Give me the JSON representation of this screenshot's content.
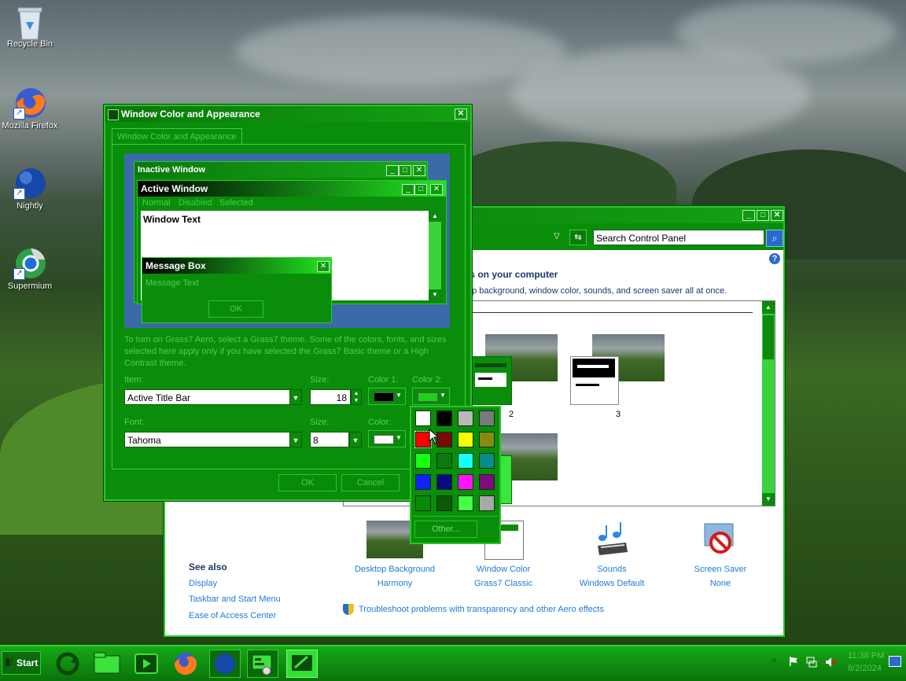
{
  "desktop": {
    "icons": [
      {
        "label": "Recycle Bin",
        "icon": "recycle-bin-icon"
      },
      {
        "label": "Mozilla Firefox",
        "icon": "firefox-icon"
      },
      {
        "label": "Nightly",
        "icon": "nightly-icon"
      },
      {
        "label": "Supermium",
        "icon": "supermium-icon"
      }
    ]
  },
  "appearance_dialog": {
    "title": "Window Color and Appearance",
    "tab_label": "Window Color and Appearance",
    "preview": {
      "inactive_title": "Inactive Window",
      "active_title": "Active Window",
      "menu_normal": "Normal",
      "menu_disabled": "Disabled",
      "menu_selected": "Selected",
      "window_text": "Window Text",
      "msgbox_title": "Message Box",
      "msgbox_text": "Message Text",
      "msgbox_ok": "OK"
    },
    "info_text": "To turn on Grass7 Aero, select a Grass7 theme. Some of the colors, fonts, and sizes selected here apply only if you have selected the Grass7 Basic theme or a High Contrast theme.",
    "item_label": "Item:",
    "item_value": "Active Title Bar",
    "size_label": "Size:",
    "size_value": "18",
    "color1_label": "Color 1:",
    "color2_label": "Color 2:",
    "color1_value": "#000000",
    "color2_value": "#1fd11f",
    "font_label": "Font:",
    "font_value": "Tahoma",
    "font_size_label": "Size:",
    "font_size_value": "8",
    "font_color_label": "Color:",
    "font_color_value": "#ffffff",
    "ok_label": "OK",
    "cancel_label": "Cancel"
  },
  "color_palette": {
    "colors": [
      "#ffffff",
      "#000000",
      "#b8b8b8",
      "#7a7a7a",
      "#ff0000",
      "#7a0a0a",
      "#ffff00",
      "#888a10",
      "#14ff14",
      "#0b7a0b",
      "#14ffff",
      "#0a8a8a",
      "#1020ff",
      "#0a0a80",
      "#ff14ff",
      "#800a80",
      "#0a8a0a",
      "#0b5a0b",
      "#46ff46",
      "#a8a8a8"
    ],
    "other_label": "Other..."
  },
  "control_panel": {
    "search_placeholder": "Search Control Panel",
    "heading": "ls on your computer",
    "subheading": "op background, window color, sounds, and screen saver all at once.",
    "theme_labels": [
      "2",
      "3"
    ],
    "see_also_title": "See also",
    "see_also_links": [
      "Display",
      "Taskbar and Start Menu",
      "Ease of Access Center"
    ],
    "bottom_items": [
      {
        "title": "Desktop Background",
        "value": "Harmony",
        "icon": "desktop-background-icon"
      },
      {
        "title": "Window Color",
        "value": "Grass7 Classic",
        "icon": "window-color-icon"
      },
      {
        "title": "Sounds",
        "value": "Windows Default",
        "icon": "sounds-icon"
      },
      {
        "title": "Screen Saver",
        "value": "None",
        "icon": "screen-saver-icon"
      }
    ],
    "troubleshoot_link": "Troubleshoot problems with transparency and other Aero effects"
  },
  "taskbar": {
    "start_label": "Start",
    "time": "11:38 PM",
    "date": "8/2/2024"
  }
}
